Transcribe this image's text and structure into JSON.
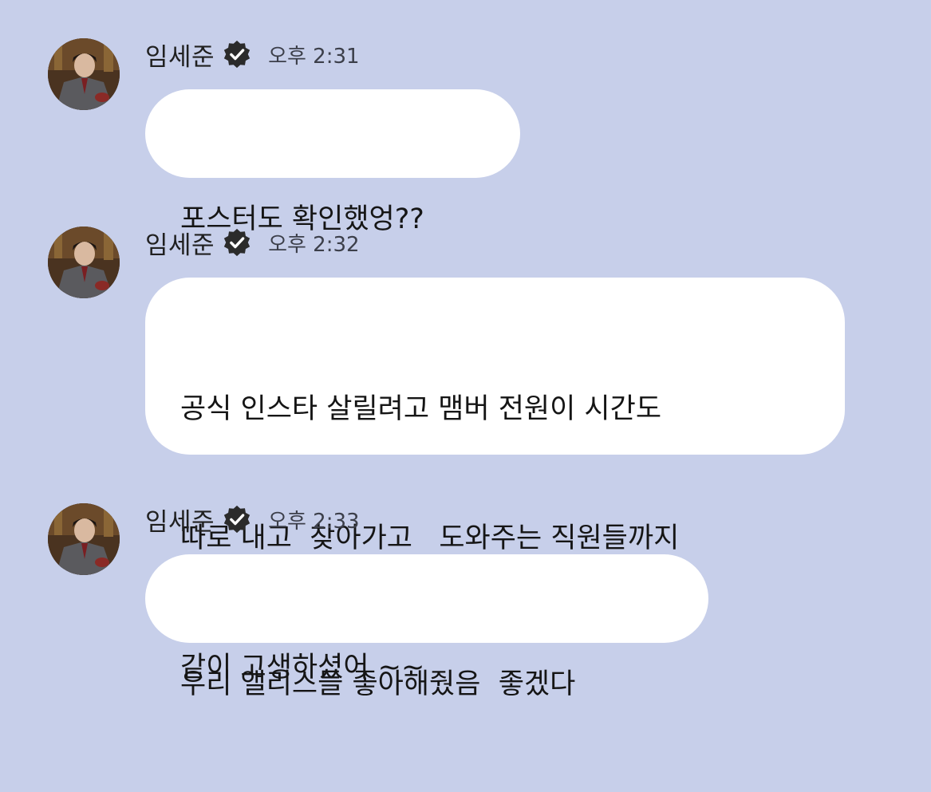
{
  "messages": [
    {
      "sender": "임세준",
      "time": "오후 2:31",
      "lines": [
        "포스터도 확인했엉??"
      ],
      "verified_icon": "verified-badge-icon",
      "avatar": "profile-avatar"
    },
    {
      "sender": "임세준",
      "time": "오후 2:32",
      "lines": [
        "공식 인스타 살릴려고 맴버 전원이 시간도",
        "따로 내고  찾아가고   도와주는 직원들까지",
        "같이 고생하셨어 ~~"
      ],
      "verified_icon": "verified-badge-icon",
      "avatar": "profile-avatar"
    },
    {
      "sender": "임세준",
      "time": "오후 2:33",
      "lines": [
        "우리 앨리스들 좋아해줬음  좋겠다"
      ],
      "verified_icon": "verified-badge-icon",
      "avatar": "profile-avatar"
    }
  ],
  "colors": {
    "background": "#c7cfea",
    "bubble": "#ffffff",
    "badge": "#2b2b2b"
  }
}
